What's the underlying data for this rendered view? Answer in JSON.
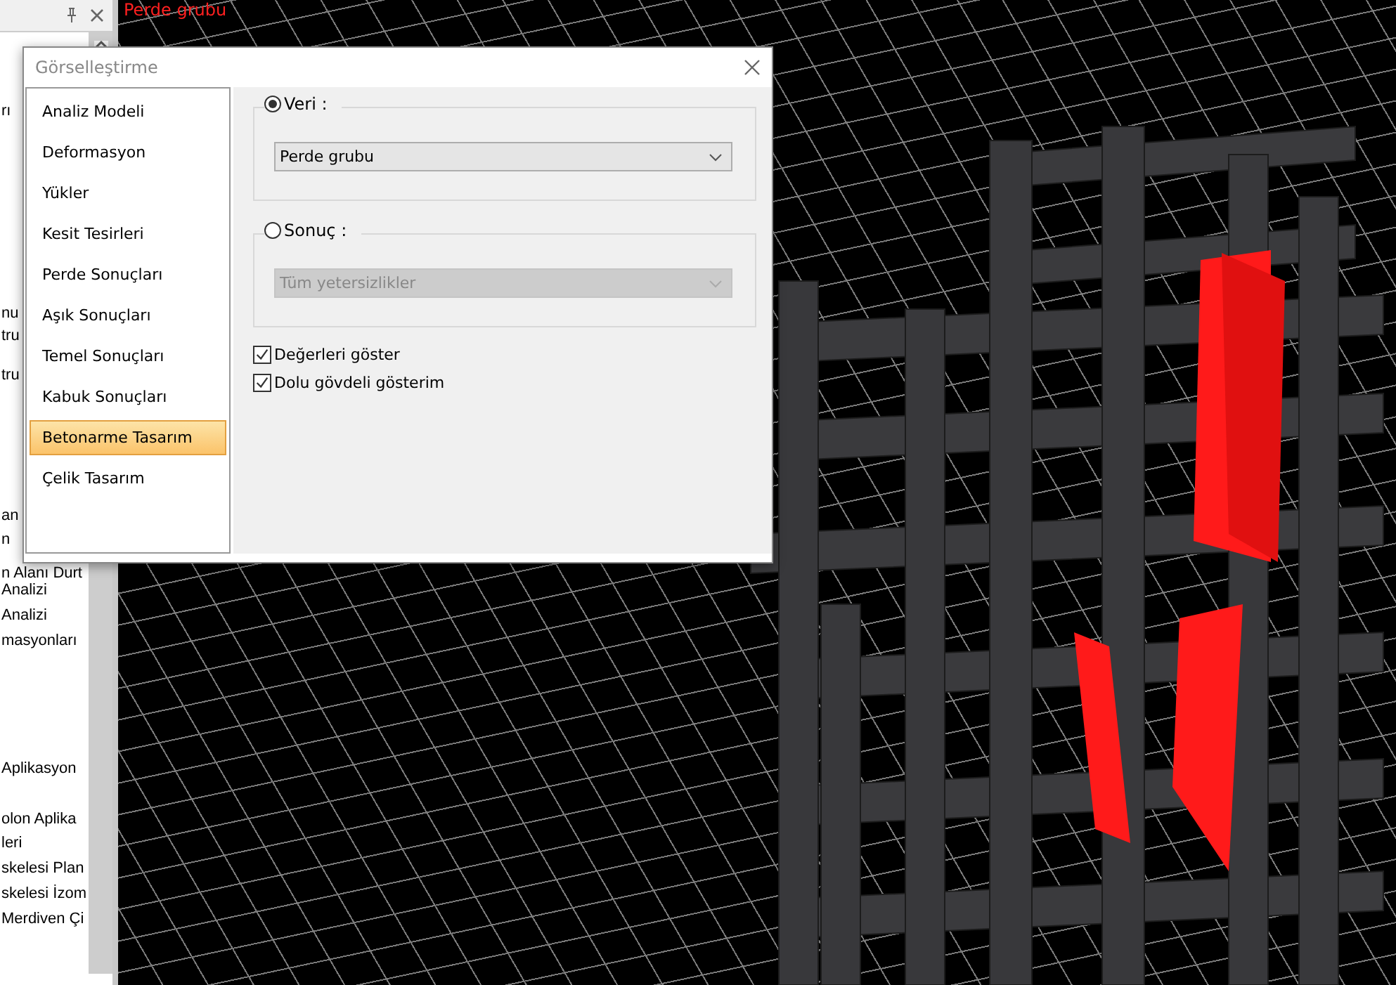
{
  "side_panel": {
    "tree_fragments": [
      "rı",
      "nu",
      "tru",
      "tru",
      "an",
      "n",
      "n Alanı Durt",
      "Analizi",
      "Analizi",
      "masyonları",
      "Aplikasyon",
      "olon Aplika",
      "leri",
      "skelesi Plan",
      "skelesi İzom",
      "Merdiven Çi"
    ]
  },
  "viewport": {
    "label": "Perde grubu"
  },
  "dialog": {
    "title": "Görselleştirme",
    "categories": [
      {
        "label": "Analiz Modeli",
        "selected": false
      },
      {
        "label": "Deformasyon",
        "selected": false
      },
      {
        "label": "Yükler",
        "selected": false
      },
      {
        "label": "Kesit Tesirleri",
        "selected": false
      },
      {
        "label": "Perde Sonuçları",
        "selected": false
      },
      {
        "label": "Aşık Sonuçları",
        "selected": false
      },
      {
        "label": "Temel Sonuçları",
        "selected": false
      },
      {
        "label": "Kabuk Sonuçları",
        "selected": false
      },
      {
        "label": "Betonarme Tasarım",
        "selected": true
      },
      {
        "label": "Çelik Tasarım",
        "selected": false
      }
    ],
    "groups": [
      {
        "label": "Veri :",
        "selected": true,
        "dropdown": {
          "value": "Perde grubu",
          "disabled": false
        }
      },
      {
        "label": "Sonuç :",
        "selected": false,
        "dropdown": {
          "value": "Tüm yetersizlikler",
          "disabled": true
        }
      }
    ],
    "options": [
      {
        "label": "Değerleri göster",
        "checked": true
      },
      {
        "label": "Dolu gövdeli gösterim",
        "checked": true
      }
    ]
  }
}
